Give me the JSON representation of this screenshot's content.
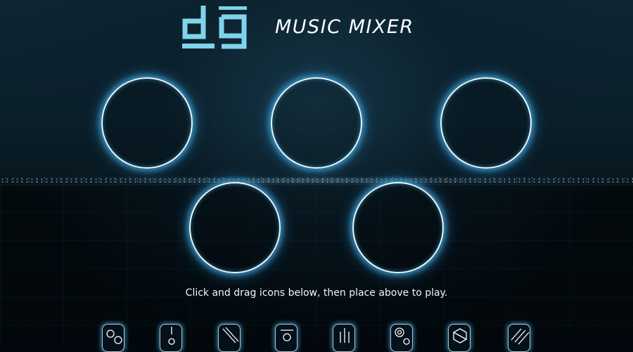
{
  "app": {
    "logo_text": "dg",
    "title": "MUSIC MIXER"
  },
  "pads": [
    {
      "name": "pad-1"
    },
    {
      "name": "pad-2"
    },
    {
      "name": "pad-3"
    },
    {
      "name": "pad-4"
    },
    {
      "name": "pad-5"
    }
  ],
  "instructions": "Click and drag icons below, then place above to play.",
  "sound_icons": [
    {
      "icon": "circles-icon"
    },
    {
      "icon": "line-circle-icon"
    },
    {
      "icon": "diagonal-lines-icon"
    },
    {
      "icon": "bar-circle-icon"
    },
    {
      "icon": "vertical-bars-icon"
    },
    {
      "icon": "concentric-circles-icon"
    },
    {
      "icon": "hexagon-icon"
    },
    {
      "icon": "slashes-icon"
    }
  ],
  "colors": {
    "accent": "#7fd3ec",
    "glow": "#46aadc",
    "text": "#ffffff"
  }
}
